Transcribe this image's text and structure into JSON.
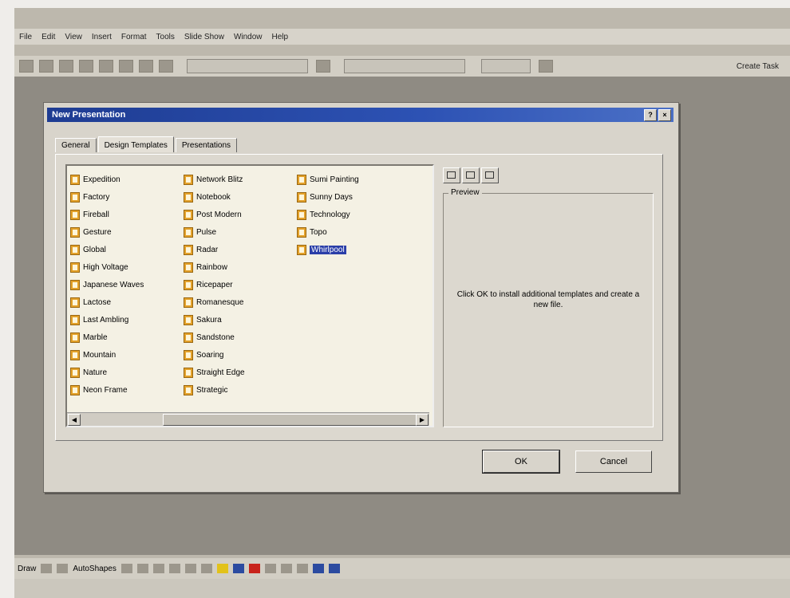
{
  "menu": [
    "File",
    "Edit",
    "View",
    "Insert",
    "Format",
    "Tools",
    "Slide Show",
    "Window",
    "Help"
  ],
  "toolbar": {
    "task_label": "Create Task"
  },
  "dialog": {
    "title": "New Presentation",
    "tabs": [
      "General",
      "Design Templates",
      "Presentations"
    ],
    "columns": [
      [
        "Expedition",
        "Factory",
        "Fireball",
        "Gesture",
        "Global",
        "High Voltage",
        "Japanese Waves",
        "Lactose",
        "Last Ambling",
        "Marble",
        "Mountain",
        "Nature",
        "Neon Frame"
      ],
      [
        "Network Blitz",
        "Notebook",
        "Post Modern",
        "Pulse",
        "Radar",
        "Rainbow",
        "Ricepaper",
        "Romanesque",
        "Sakura",
        "Sandstone",
        "Soaring",
        "Straight Edge",
        "Strategic"
      ],
      [
        "Sumi Painting",
        "Sunny Days",
        "Technology",
        "Topo",
        "Whirlpool"
      ]
    ],
    "selected_item": "Whirlpool",
    "preview_label": "Preview",
    "preview_text": "Click OK to install additional templates and create a new file.",
    "ok_label": "OK",
    "cancel_label": "Cancel"
  },
  "drawing": {
    "draw_label": "Draw",
    "autoshapes_label": "AutoShapes"
  },
  "colors": {
    "title_bar": "#1e3c92",
    "selection": "#2a3ea8"
  }
}
